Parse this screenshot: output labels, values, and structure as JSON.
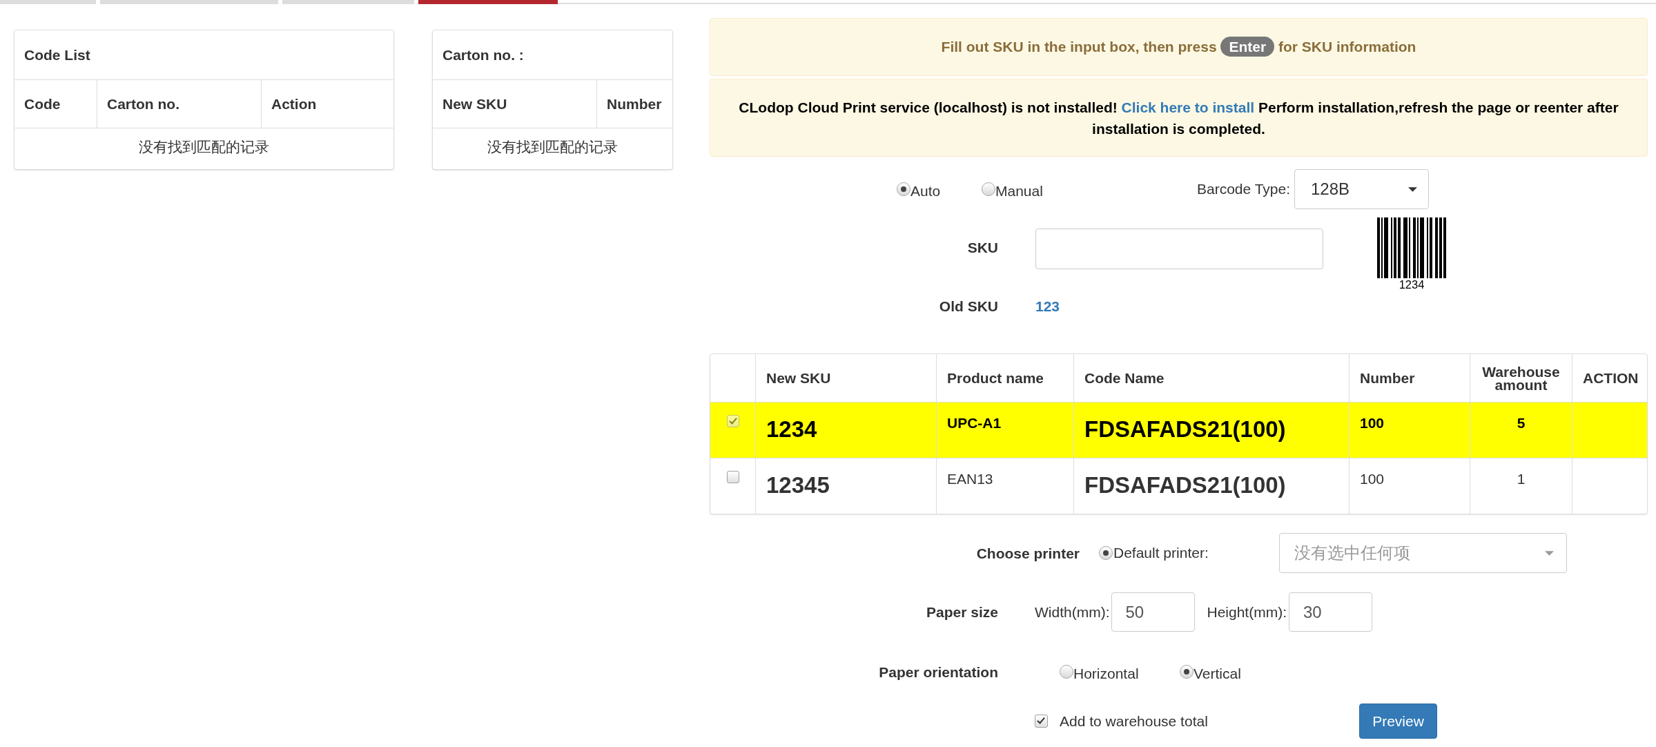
{
  "tabs": [
    {
      "selected": false
    },
    {
      "selected": false
    },
    {
      "selected": false
    },
    {
      "selected": true
    }
  ],
  "code_list": {
    "title": "Code List",
    "columns": [
      "Code",
      "Carton no.",
      "Action"
    ],
    "empty_message": "没有找到匹配的记录"
  },
  "carton_panel": {
    "title": "Carton no. :",
    "columns": [
      "New SKU",
      "Number"
    ],
    "empty_message": "没有找到匹配的记录"
  },
  "sku_hint": {
    "before": "Fill out SKU in the input box, then press",
    "key": "Enter",
    "after": "for SKU information"
  },
  "print_service_alert": {
    "before": "CLodop Cloud Print service (localhost) is not installed!",
    "link": "Click here to install",
    "after": "Perform installation,refresh the page or reenter after installation is completed."
  },
  "mode_options": [
    {
      "label": "Auto",
      "selected": true
    },
    {
      "label": "Manual",
      "selected": false
    }
  ],
  "barcode_type": {
    "label": "Barcode Type:",
    "value": "128B"
  },
  "sku_field": {
    "label": "SKU"
  },
  "barcode_preview": {
    "caption": "1234"
  },
  "old_sku": {
    "label": "Old SKU",
    "value": "123"
  },
  "sku_table": {
    "columns": [
      "New SKU",
      "Product name",
      "Code Name",
      "Number",
      "Warehouse amount",
      "ACTION"
    ],
    "rows": [
      {
        "selected": true,
        "checked": true,
        "new_sku": "1234",
        "product_name": "UPC-A1",
        "code_name": "FDSAFADS21(100)",
        "number": "100",
        "warehouse_amount": "5"
      },
      {
        "selected": false,
        "checked": false,
        "new_sku": "12345",
        "product_name": "EAN13",
        "code_name": "FDSAFADS21(100)",
        "number": "100",
        "warehouse_amount": "1"
      }
    ]
  },
  "printer": {
    "label": "Choose printer",
    "option": {
      "label": "Default printer:",
      "selected": true
    },
    "placeholder": "没有选中任何项"
  },
  "paper_size": {
    "label": "Paper size",
    "width": {
      "label": "Width(mm):",
      "value": "50"
    },
    "height": {
      "label": "Height(mm):",
      "value": "30"
    }
  },
  "orientation": {
    "label": "Paper orientation",
    "options": [
      {
        "label": "Horizontal",
        "selected": false
      },
      {
        "label": "Vertical",
        "selected": true
      }
    ]
  },
  "add_to_total": {
    "label": "Add to warehouse total",
    "checked": true
  },
  "preview_button": {
    "label": "Preview"
  }
}
